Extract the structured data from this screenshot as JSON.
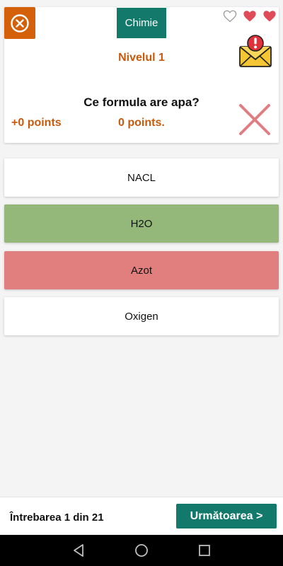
{
  "header": {
    "category": "Chimie",
    "level": "Nivelul 1",
    "lives_total": 3,
    "lives_lost": 1
  },
  "question": {
    "text": "Ce formula are apa?",
    "points_gained": "+0 points",
    "points_total": "0 points.",
    "result_icon": "wrong-x-icon"
  },
  "answers": [
    {
      "label": "NACL",
      "state": "neutral"
    },
    {
      "label": "H2O",
      "state": "correct"
    },
    {
      "label": "Azot",
      "state": "wrong"
    },
    {
      "label": "Oxigen",
      "state": "neutral"
    }
  ],
  "footer": {
    "progress": "Întrebarea 1 din 21",
    "next_label": "Următoarea >"
  },
  "colors": {
    "accent_orange": "#d4600a",
    "teal": "#137a6b",
    "correct_green": "#93b87a",
    "wrong_red": "#e17f7f",
    "heart_red": "#e04b5a"
  },
  "icons": [
    "close-circle-icon",
    "heart-outline-icon",
    "heart-filled-icon",
    "mail-alert-icon",
    "wrong-x-icon",
    "nav-back-icon",
    "nav-home-icon",
    "nav-recents-icon"
  ]
}
